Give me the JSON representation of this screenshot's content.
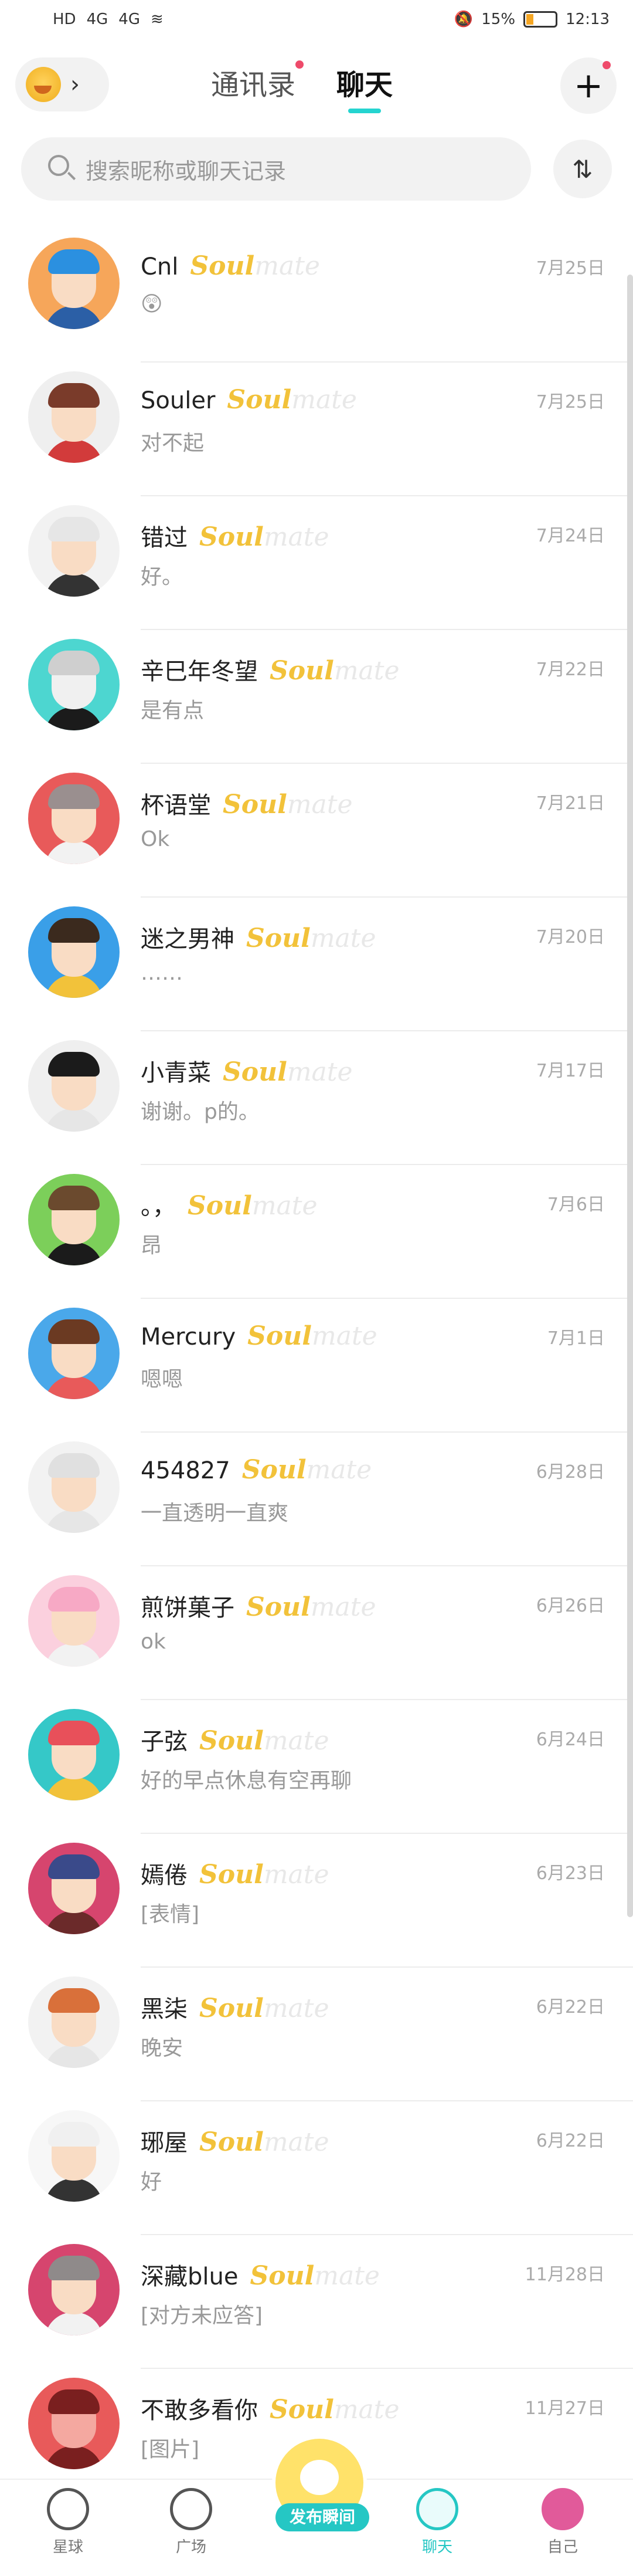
{
  "status_bar": {
    "left": [
      "HD",
      "4G",
      "4G"
    ],
    "battery": "15%",
    "time": "12:13"
  },
  "header": {
    "tabs": [
      {
        "label": "通讯录",
        "active": false,
        "has_badge": true
      },
      {
        "label": "聊天",
        "active": true,
        "has_badge": false
      }
    ],
    "plus_label": "+"
  },
  "search": {
    "placeholder": "搜索昵称或聊天记录",
    "sort_label": "⇅"
  },
  "brand": {
    "part1": "Soul",
    "part2": "mate"
  },
  "chats": [
    {
      "name": "Cnl",
      "msg": "😲",
      "date": "7月25日",
      "hair": "#2b90e0",
      "skin": "#f9dcc4",
      "bg": "#f6a65a",
      "shirt": "#2b5fa6"
    },
    {
      "name": "Souler",
      "msg": "对不起",
      "date": "7月25日",
      "hair": "#7a3b2a",
      "skin": "#f9dcc4",
      "bg": "#efefef",
      "shirt": "#d23b3b"
    },
    {
      "name": "错过",
      "msg": "好。",
      "date": "7月24日",
      "hair": "#e6e6e6",
      "skin": "#f9dcc4",
      "bg": "#f2f2f2",
      "shirt": "#333333"
    },
    {
      "name": "辛巳年冬望",
      "msg": "是有点",
      "date": "7月22日",
      "hair": "#cfcfcf",
      "skin": "#f0f0f0",
      "bg": "#4dd6d0",
      "shirt": "#1b1b1b"
    },
    {
      "name": "杯语堂",
      "msg": "Ok",
      "date": "7月21日",
      "hair": "#9a8f8f",
      "skin": "#f9dcc4",
      "bg": "#e85a5a",
      "shirt": "#f2f2f2"
    },
    {
      "name": "迷之男神",
      "msg": "……",
      "date": "7月20日",
      "hair": "#3b2a1e",
      "skin": "#f9dcc4",
      "bg": "#3a9fe8",
      "shirt": "#f2c23a"
    },
    {
      "name": "小青菜",
      "msg": "谢谢。p的。",
      "date": "7月17日",
      "hair": "#1b1b1b",
      "skin": "#f9dcc4",
      "bg": "#efefef",
      "shirt": "#e6e6e6"
    },
    {
      "name": "。，",
      "msg": "昂",
      "date": "7月6日",
      "hair": "#6b4a2e",
      "skin": "#f9dcc4",
      "bg": "#7ccf5a",
      "shirt": "#1b1b1b"
    },
    {
      "name": "Mercury",
      "msg": "嗯嗯",
      "date": "7月1日",
      "hair": "#6b3a22",
      "skin": "#f9dcc4",
      "bg": "#4aa8ea",
      "shirt": "#e85a5a"
    },
    {
      "name": "454827",
      "msg": "一直透明一直爽",
      "date": "6月28日",
      "hair": "#e0e0e0",
      "skin": "#f9dcc4",
      "bg": "#f2f2f2",
      "shirt": "#e6e6e6"
    },
    {
      "name": "煎饼菓子",
      "msg": "ok",
      "date": "6月26日",
      "hair": "#f7a9c5",
      "skin": "#f9dcc4",
      "bg": "#fbd0de",
      "shirt": "#f2f2f2"
    },
    {
      "name": "子弦",
      "msg": "好的早点休息有空再聊",
      "date": "6月24日",
      "hair": "#e8505a",
      "skin": "#f9dcc4",
      "bg": "#35c8c8",
      "shirt": "#f2c23a"
    },
    {
      "name": "嫣倦",
      "msg": "[表情]",
      "date": "6月23日",
      "hair": "#3a4a8a",
      "skin": "#f9dcc4",
      "bg": "#d6456e",
      "shirt": "#6b2a2a"
    },
    {
      "name": "黑柒",
      "msg": "晚安",
      "date": "6月22日",
      "hair": "#d9703a",
      "skin": "#f9dcc4",
      "bg": "#f2f2f2",
      "shirt": "#e6e6e6"
    },
    {
      "name": "琊屋",
      "msg": "好",
      "date": "6月22日",
      "hair": "#f0f0f0",
      "skin": "#f9dcc4",
      "bg": "#f7f7f7",
      "shirt": "#333333"
    },
    {
      "name": "深藏blue",
      "msg": "[对方未应答]",
      "date": "11月28日",
      "hair": "#8f8a8a",
      "skin": "#f9dcc4",
      "bg": "#d6456e",
      "shirt": "#f2f2f2"
    },
    {
      "name": "不敢多看你",
      "msg": "[图片]",
      "date": "11月27日",
      "hair": "#7a1f1f",
      "skin": "#f4a8a0",
      "bg": "#e85a5a",
      "shirt": "#7a1f1f"
    }
  ],
  "bottom_nav": {
    "items": [
      {
        "label": "星球",
        "active": false
      },
      {
        "label": "广场",
        "active": false
      },
      {
        "label": "聊天",
        "active": true
      },
      {
        "label": "自己",
        "active": false
      }
    ],
    "publish_label": "发布瞬间"
  },
  "colors": {
    "accent": "#25c7c4",
    "badge": "#ee4a6a",
    "brand_gold": "#f2c23a"
  }
}
